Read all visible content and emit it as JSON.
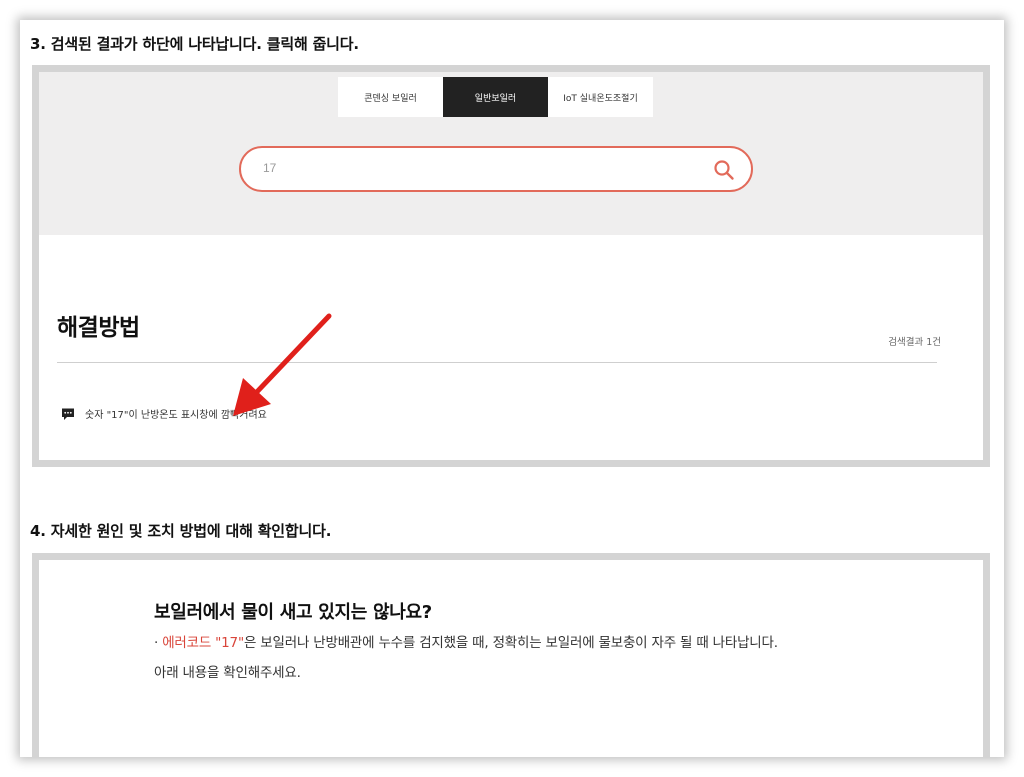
{
  "step3": {
    "heading": "3. 검색된 결과가 하단에 나타납니다. 클릭해 줍니다."
  },
  "search_panel": {
    "tabs": [
      {
        "label": "콘덴싱 보일러",
        "active": false
      },
      {
        "label": "일반보일러",
        "active": true
      },
      {
        "label": "IoT 실내온도조절기",
        "active": false
      }
    ],
    "search_value": "17",
    "search_icon": "search-icon",
    "accent_color": "#e26a5a"
  },
  "results": {
    "title": "해결방법",
    "count_label": "검색결과 1건",
    "items": [
      {
        "icon": "chat-icon",
        "text": "숫자 \"17\"이 난방온도 표시창에 깜빡거려요"
      }
    ]
  },
  "step4": {
    "heading": "4. 자세한 원인 및 조치 방법에 대해 확인합니다."
  },
  "detail": {
    "question": "보일러에서 물이 새고 있지는 않나요?",
    "line1_prefix": "· ",
    "line1_code": "에러코드 \"17\"",
    "line1_rest": "은 보일러나 난방배관에 누수를 검지했을 때, 정확히는 보일러에 물보충이 자주 될 때 나타납니다.",
    "line2": "아래 내용을 확인해주세요.",
    "code_color": "#d9453a"
  }
}
